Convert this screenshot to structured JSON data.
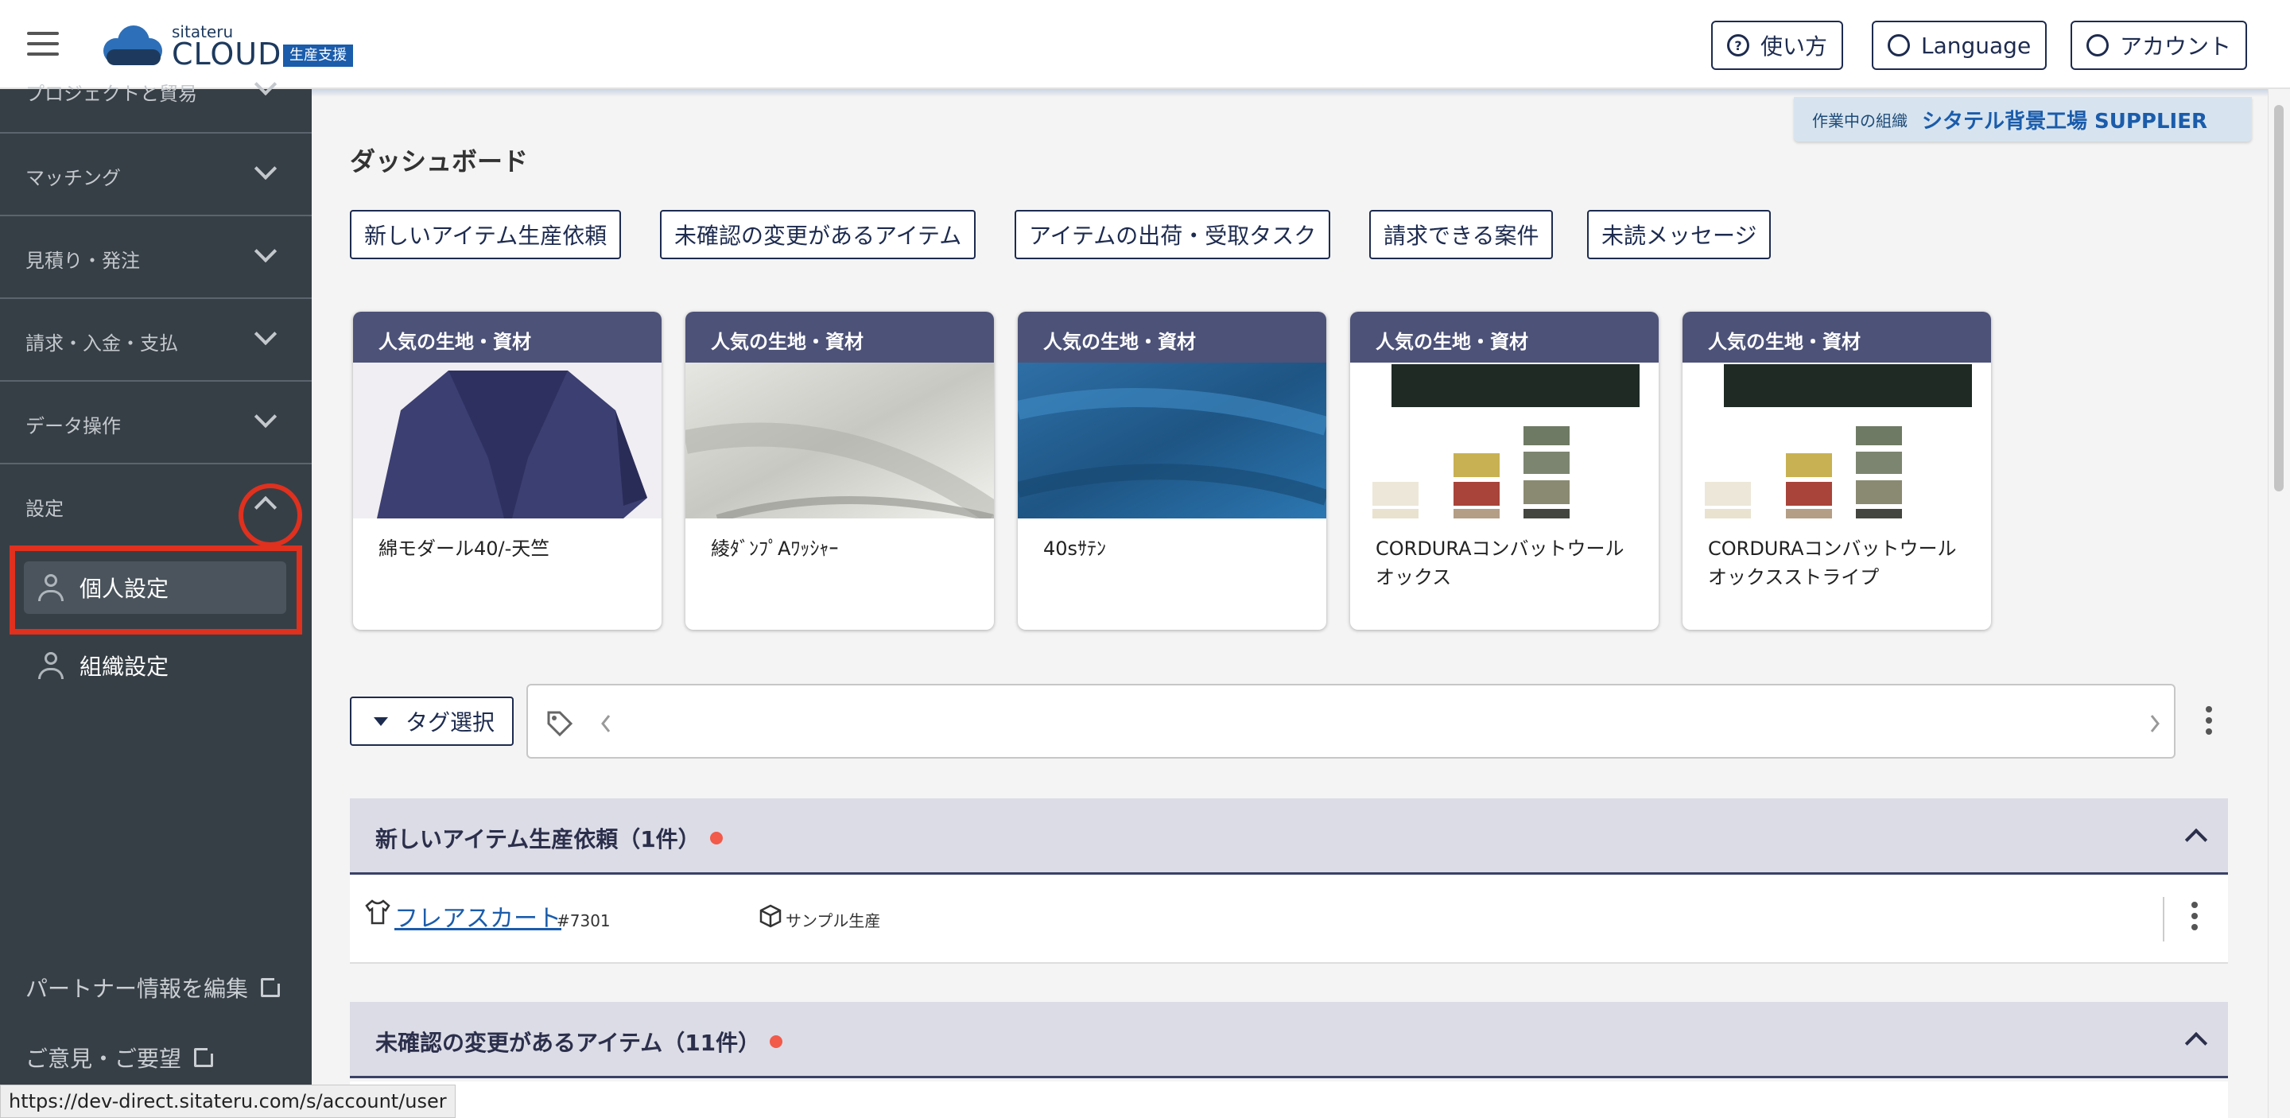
{
  "header": {
    "brand_small": "sitateru",
    "brand_main": "CLOUD",
    "brand_badge": "生産支援",
    "help_label": "使い方",
    "language_label": "Language",
    "account_label": "アカウント"
  },
  "sidebar": {
    "sections": [
      {
        "label": "プロジェクトと貿易"
      },
      {
        "label": "マッチング"
      },
      {
        "label": "見積り・発注"
      },
      {
        "label": "請求・入金・支払"
      },
      {
        "label": "データ操作"
      },
      {
        "label": "設定"
      }
    ],
    "settings_items": [
      {
        "label": "個人設定"
      },
      {
        "label": "組織設定"
      }
    ],
    "partner_link": "パートナー情報を編集",
    "feedback_link": "ご意見・ご要望"
  },
  "org": {
    "label": "作業中の組織",
    "name": "シタテル背景工場 SUPPLIER"
  },
  "main": {
    "title": "ダッシュボード",
    "filters": [
      "新しいアイテム生産依頼",
      "未確認の変更があるアイテム",
      "アイテムの出荷・受取タスク",
      "請求できる案件",
      "未読メッセージ"
    ],
    "cards": [
      {
        "header": "人気の生地・資材",
        "name": "綿モダール40/-天竺"
      },
      {
        "header": "人気の生地・資材",
        "name": "綾ﾀﾞﾝﾌﾟAﾜｯｼｬｰ"
      },
      {
        "header": "人気の生地・資材",
        "name": "40sｻﾃﾝ"
      },
      {
        "header": "人気の生地・資材",
        "name": "CORDURAコンバットウールオックス"
      },
      {
        "header": "人気の生地・資材",
        "name": "CORDURAコンバットウールオックスストライプ"
      }
    ],
    "tag_button": "タグ選択",
    "sections": [
      {
        "title": "新しいアイテム生産依頼（1件）"
      },
      {
        "title": "未確認の変更があるアイテム（11件）"
      }
    ],
    "row": {
      "name": "フレアスカート",
      "number": "#7301",
      "type": "サンプル生産"
    }
  },
  "status_url": "https://dev-direct.sitateru.com/s/account/user",
  "colors": {
    "sidebar": "#373f46",
    "card_header": "#4d5278",
    "highlight": "#e0301e",
    "accent": "#1b5cab"
  }
}
